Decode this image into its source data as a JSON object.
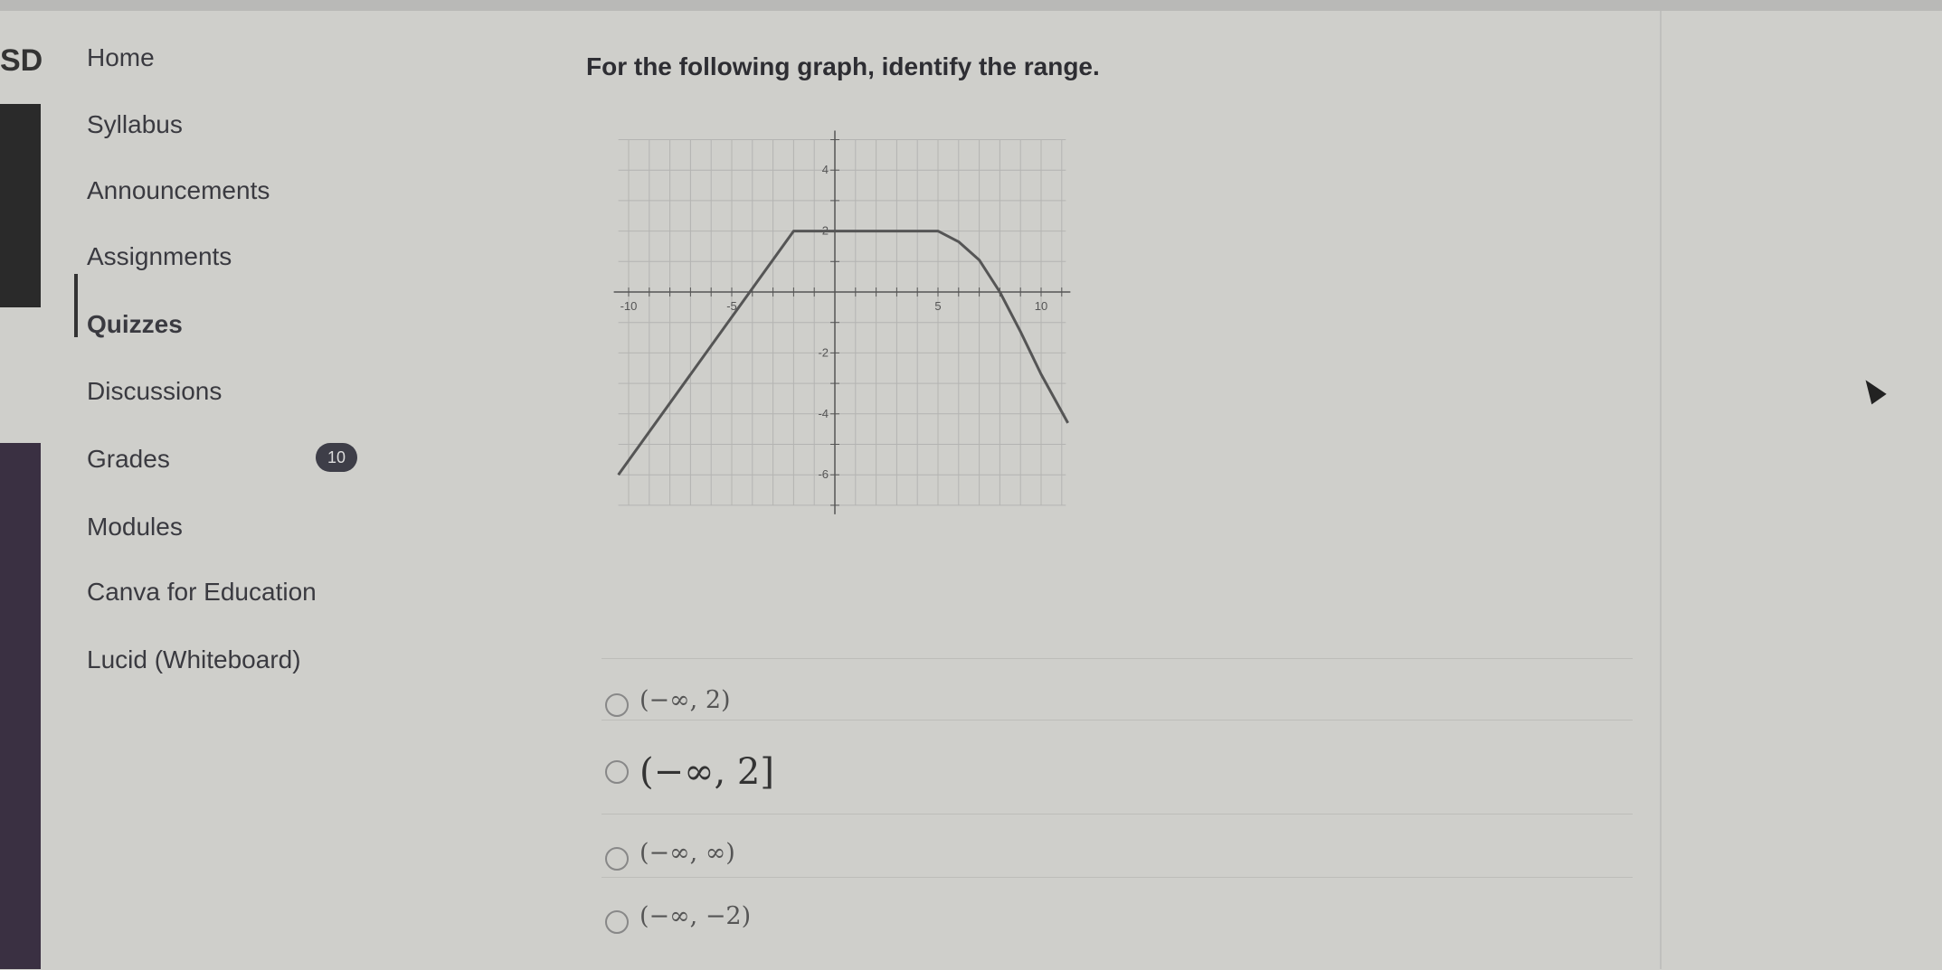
{
  "sidebar": {
    "logo_text": "SD",
    "items": [
      {
        "label": "Home"
      },
      {
        "label": "Syllabus"
      },
      {
        "label": "Announcements"
      },
      {
        "label": "Assignments"
      },
      {
        "label": "Quizzes",
        "active": true
      },
      {
        "label": "Discussions"
      },
      {
        "label": "Grades",
        "badge": "10"
      },
      {
        "label": "Modules"
      },
      {
        "label": "Canva for Education"
      },
      {
        "label": "Lucid (Whiteboard)"
      }
    ]
  },
  "question": {
    "text": "For the following graph, identify the range.",
    "options": [
      {
        "label": "(−∞, 2)"
      },
      {
        "label": "(−∞, 2]"
      },
      {
        "label": "(−∞, ∞)"
      },
      {
        "label": "(−∞, −2)"
      }
    ]
  },
  "chart_data": {
    "type": "line",
    "xlim": [
      -10.5,
      11.2
    ],
    "ylim": [
      -7,
      5
    ],
    "grid": true,
    "x_tick_labels": [
      "-10",
      "-5",
      "5",
      "10"
    ],
    "x_tick_values": [
      -10,
      -5,
      5,
      10
    ],
    "y_tick_labels": [
      "4",
      "2",
      "-2",
      "-4",
      "-6"
    ],
    "y_tick_values": [
      4,
      2,
      -2,
      -4,
      -6
    ],
    "series": [
      {
        "points": [
          [
            -10.5,
            -6
          ],
          [
            -2,
            2
          ],
          [
            5,
            2
          ],
          [
            6,
            1.65
          ],
          [
            7,
            1.05
          ],
          [
            8,
            0
          ],
          [
            9,
            -1.3
          ],
          [
            10,
            -2.7
          ],
          [
            11.3,
            -4.3
          ]
        ]
      }
    ],
    "line_color": "#555555"
  }
}
